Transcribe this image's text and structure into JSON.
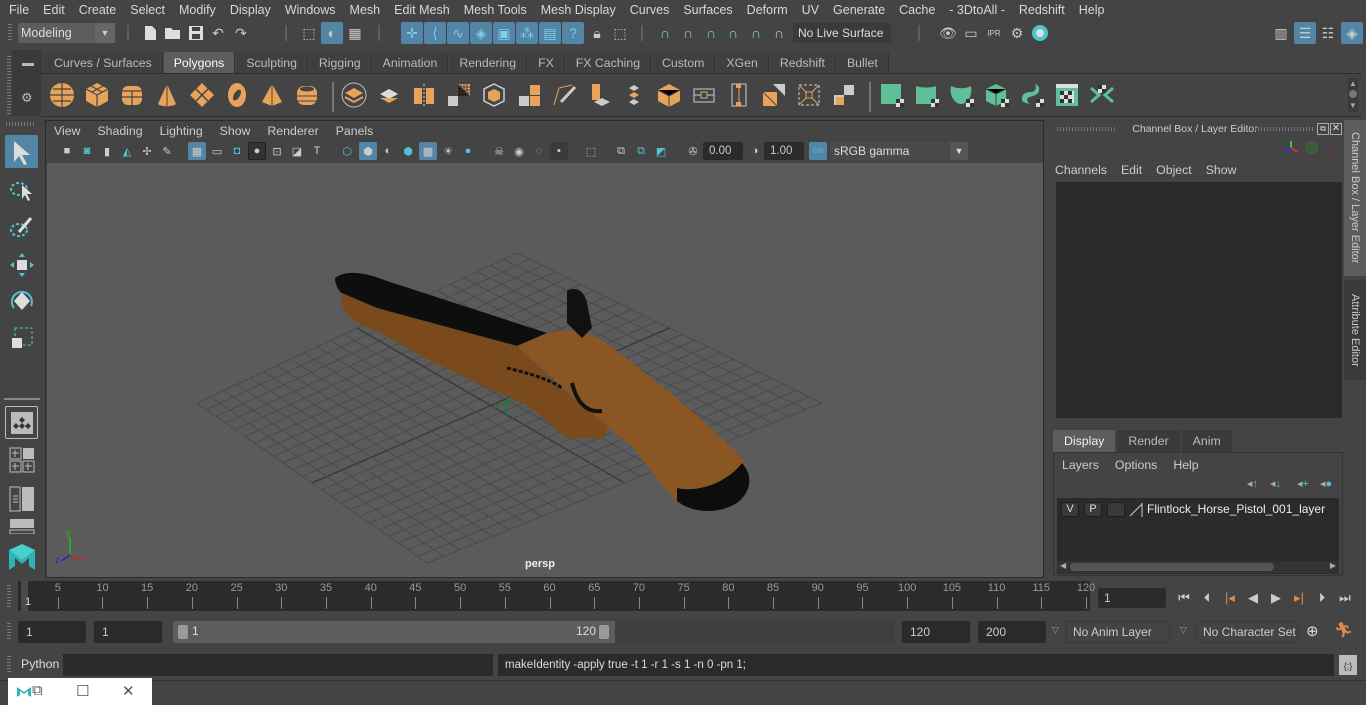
{
  "menubar": {
    "items": [
      "File",
      "Edit",
      "Create",
      "Select",
      "Modify",
      "Display",
      "Windows",
      "Mesh",
      "Edit Mesh",
      "Mesh Tools",
      "Mesh Display",
      "Curves",
      "Surfaces",
      "Deform",
      "UV",
      "Generate",
      "Cache",
      "- 3DtoAll -",
      "Redshift",
      "Help"
    ]
  },
  "statusline": {
    "mode": "Modeling",
    "live_surface": "No Live Surface",
    "icons": [
      "new-scene-icon",
      "open-scene-icon",
      "save-scene-icon",
      "undo-icon",
      "redo-icon",
      "select-hierarchy-icon",
      "select-object-icon",
      "select-component-icon",
      "snap-grid-icon",
      "snap-curve-icon",
      "snap-point-icon",
      "snap-projected-icon",
      "snap-view-plane-icon",
      "make-live-icon",
      "help-icon",
      "lock-icon",
      "select-camera-icon",
      "render-view-icon",
      "render-current-icon",
      "ipr-render-icon",
      "render-settings-icon",
      "hypershade-icon"
    ]
  },
  "shelf": {
    "tabs": [
      "Curves / Surfaces",
      "Polygons",
      "Sculpting",
      "Rigging",
      "Animation",
      "Rendering",
      "FX",
      "FX Caching",
      "Custom",
      "XGen",
      "Redshift",
      "Bullet"
    ],
    "active_tab": "Polygons"
  },
  "viewport": {
    "menu": [
      "View",
      "Shading",
      "Lighting",
      "Show",
      "Renderer",
      "Panels"
    ],
    "exposure": "0.00",
    "gamma": "1.00",
    "color_mgmt": "ON",
    "color_space": "sRGB gamma",
    "camera_label": "persp",
    "axis": {
      "x": "x",
      "y": "y",
      "z": "z"
    }
  },
  "channel_box": {
    "title": "Channel Box / Layer Editor",
    "menu": [
      "Channels",
      "Edit",
      "Object",
      "Show"
    ]
  },
  "layer_editor": {
    "tabs": [
      "Display",
      "Render",
      "Anim"
    ],
    "active_tab": "Display",
    "menu": [
      "Layers",
      "Options",
      "Help"
    ],
    "layers": [
      {
        "visible": "V",
        "playback": "P",
        "name": "Flintlock_Horse_Pistol_001_layer"
      }
    ]
  },
  "side_tabs": [
    "Channel Box / Layer Editor",
    "Attribute Editor"
  ],
  "timeline": {
    "ticks": [
      "5",
      "10",
      "15",
      "20",
      "25",
      "30",
      "35",
      "40",
      "45",
      "50",
      "55",
      "60",
      "65",
      "70",
      "75",
      "80",
      "85",
      "90",
      "95",
      "100",
      "105",
      "110",
      "115",
      "120"
    ],
    "current_marker": "1",
    "current_frame": "1",
    "start": 1,
    "end": 120
  },
  "range": {
    "start_time": "1",
    "playback_start": "1",
    "range_start_label": "1",
    "range_end_label": "120",
    "playback_end": "120",
    "end_time": "200",
    "anim_layer": "No Anim Layer",
    "character_set": "No Character Set"
  },
  "command_line": {
    "language": "Python",
    "input": "",
    "result": "makeIdentity -apply true -t 1 -r 1 -s 1 -n 0 -pn 1;"
  },
  "colors": {
    "accent": "#5285a6",
    "shelf_poly": "#e8a35a",
    "shelf_green": "#5fbf97",
    "teal": "#4ec3d4"
  }
}
